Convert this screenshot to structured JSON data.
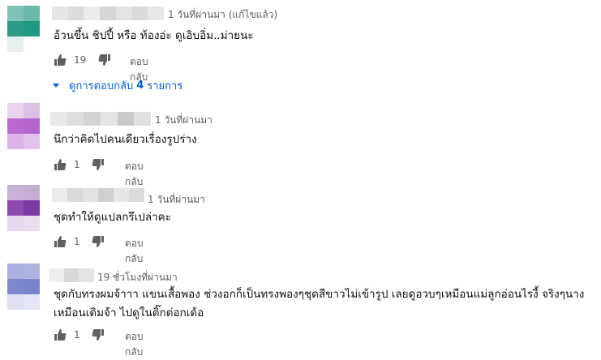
{
  "comments": [
    {
      "time": "1 วันที่ผ่านมา (แก้ไขแล้ว)",
      "text_lines": [
        "อ้วนขึ้น ชิปปี้ หรือ ท้องอ่ะ ดูเอิบอิ่ม..ม่ายนะ"
      ],
      "likes": "19",
      "reply_label": "ตอบกลับ",
      "avatar_colors": [
        "#7fc3b8",
        "#6bb9ac",
        "#2e9c87",
        "#1f9a80",
        "#e4f1ee",
        "#ffffff"
      ],
      "view_replies": {
        "prefix": "ดูการตอบกลับ",
        "count": "4",
        "suffix": "รายการ"
      }
    },
    {
      "time": "1 วันที่ผ่านมา",
      "text_lines": [
        "นึกว่าคิดไปคนเดียวเรื่องรูปร่าง"
      ],
      "likes": "1",
      "reply_label": "ตอบกลับ",
      "avatar_colors": [
        "#e9d4ee",
        "#ddc0e6",
        "#b96ad0",
        "#b466cc",
        "#dcb2e7",
        "#e2c1ea"
      ]
    },
    {
      "time": "1 วันที่ผ่านมา",
      "text_lines": [
        "ชุดทำให้ดูแปลกรึเปล่าคะ"
      ],
      "likes": "1",
      "reply_label": "ตอบกลับ",
      "avatar_colors": [
        "#c8b2d8",
        "#c4aed6",
        "#8d4bb1",
        "#7c3aa6",
        "#e5d8ee",
        "#e8def0"
      ]
    },
    {
      "time": "19 ชั่วโมงที่ผ่านมา",
      "text_lines": [
        "ชุดกับทรงผมจ้าาา แขนเสื้อพอง ช่วงอกก็เป็นทรงพองๆชุดสีขาวไม่เข้ารูป เลยดูอวบๆเหมือนแม่ลูกอ่อนไรงี้ จริงๆนาง",
        "เหมือนเดิมจ้า ไปดูในติ๊กต่อกเด้อ"
      ],
      "likes": "1",
      "reply_label": "ตอบกลับ",
      "avatar_colors": [
        "#a9b0e0",
        "#aeb4e2",
        "#7f88cf",
        "#7a84cd",
        "#dfe1f3",
        "#e4e6f5"
      ]
    }
  ]
}
